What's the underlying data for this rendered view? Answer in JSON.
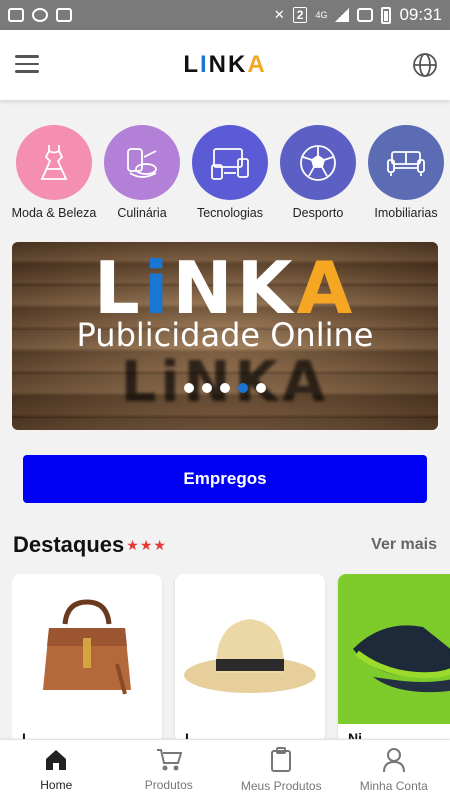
{
  "status_bar": {
    "time": "09:31",
    "notification_count": "2",
    "network": "4G"
  },
  "app": {
    "logo_prefix": "L",
    "logo_i": "I",
    "logo_mid": "NK",
    "logo_a": "A"
  },
  "categories": [
    {
      "label": "Moda & Beleza",
      "icon": "dress-icon",
      "color": "#f48fb1"
    },
    {
      "label": "Culinária",
      "icon": "cooking-icon",
      "color": "#b380d8"
    },
    {
      "label": "Tecnologias",
      "icon": "devices-icon",
      "color": "#5b5bd6"
    },
    {
      "label": "Desporto",
      "icon": "soccer-ball-icon",
      "color": "#5c5fc4"
    },
    {
      "label": "Imobiliarias",
      "icon": "sofa-icon",
      "color": "#5b6cb5"
    }
  ],
  "banner": {
    "logo_prefix": "L",
    "logo_i": "i",
    "logo_mid": "NK",
    "logo_a": "A",
    "title": "Publicidade Online",
    "shadow_text": "LiNKA",
    "dots": 4,
    "active_dot": 3
  },
  "jobs_button": {
    "label": "Empregos"
  },
  "featured": {
    "title": "Destaques",
    "stars": "★★★",
    "see_more": "Ver mais",
    "items": [
      {
        "name": "L...",
        "image": "handbag-image"
      },
      {
        "name": "L...",
        "image": "hat-image"
      },
      {
        "name": "Ni...",
        "image": "sneakers-image"
      }
    ]
  },
  "bottom_nav": [
    {
      "label": "Home",
      "icon": "home-icon",
      "active": true
    },
    {
      "label": "Produtos",
      "icon": "cart-icon",
      "active": false
    },
    {
      "label": "Meus Produtos",
      "icon": "clipboard-icon",
      "active": false
    },
    {
      "label": "Minha Conta",
      "icon": "user-icon",
      "active": false
    }
  ],
  "colors": {
    "primary_button": "#0000f5",
    "accent_orange": "#f5a623",
    "accent_blue": "#1976d2",
    "stars": "#e53935"
  }
}
